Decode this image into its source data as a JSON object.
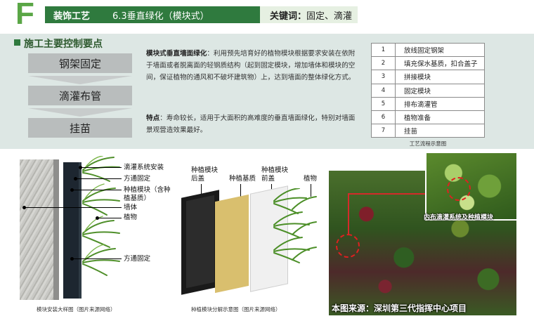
{
  "header": {
    "letter": "F",
    "category": "装饰工艺",
    "section": "6.3垂直绿化（模块式）",
    "keyword_label": "关键词：",
    "keywords": "固定、滴灌"
  },
  "control": {
    "title": "施工主要控制要点",
    "steps": [
      "钢架固定",
      "滴灌布管",
      "挂苗"
    ]
  },
  "description": {
    "p1_label": "模块式垂直墙面绿化",
    "p1_text": "：利用预先培育好的植物模块根据要求安装在依附于墙面或者脱离面的轻钢质结构（起到固定模块，增加墙体和模块的空间，保证植物的通风和不破坏建筑物）上，达到墙面的整体绿化方式。",
    "p2_label": "特点",
    "p2_text": "：寿命较长，适用于大面积的高难度的垂直墙面绿化，特别对墙面景观营造效果最好。"
  },
  "flow_table": {
    "rows": [
      {
        "no": "1",
        "text": "放线固定钢架"
      },
      {
        "no": "2",
        "text": "填充保水基质，扣合盖子"
      },
      {
        "no": "3",
        "text": "拼接模块"
      },
      {
        "no": "4",
        "text": "固定模块"
      },
      {
        "no": "5",
        "text": "排布滴灌管"
      },
      {
        "no": "6",
        "text": "植物准备"
      },
      {
        "no": "7",
        "text": "挂苗"
      }
    ],
    "caption": "工艺流程示意图"
  },
  "install_diagram": {
    "labels": {
      "drip": "滴灌系统安装",
      "square_top": "方通固定",
      "module_line1": "种植模块（含种",
      "module_line2": "植基质）",
      "wall": "墙体",
      "plant": "植物",
      "square_bottom": "方通固定"
    },
    "caption": "模块安装大样图（图片来源网络）"
  },
  "module_diagram": {
    "labels": {
      "back_line1": "种植模块",
      "back_line2": "后盖",
      "base": "种植基质",
      "front_line1": "种植模块",
      "front_line2": "前盖",
      "plant": "植物"
    },
    "caption": "种植模块分解示意图（图片来源网络）"
  },
  "photo": {
    "inset_caption": "内布滴灌系统及种植模块",
    "source_caption": "本图来源：深圳第三代指挥中心项目"
  },
  "colors": {
    "brand_green": "#2f7a3e",
    "letter_green": "#5aa646",
    "panel_bg": "#dde7e4",
    "step_gray": "#b9bdbd",
    "mark_red": "#e02020"
  }
}
